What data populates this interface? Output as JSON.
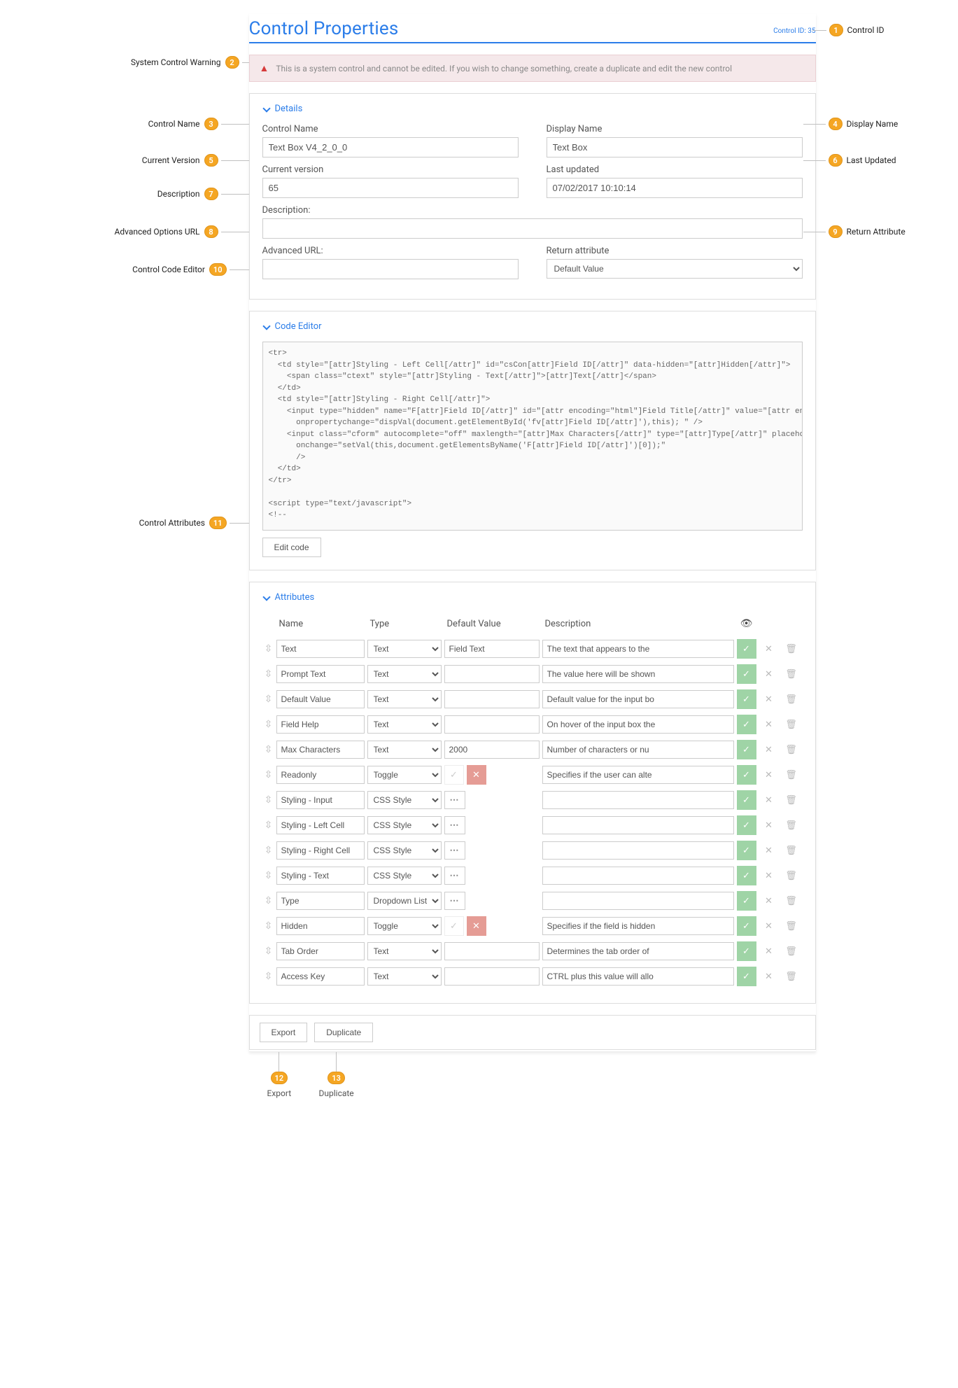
{
  "header": {
    "title": "Control Properties",
    "control_id_label": "Control ID: 35"
  },
  "warning": {
    "text": "This is a system control and cannot be edited. If you wish to change something, create a duplicate and edit the new control"
  },
  "details": {
    "section_title": "Details",
    "control_name_label": "Control Name",
    "control_name_value": "Text Box V4_2_0_0",
    "display_name_label": "Display Name",
    "display_name_value": "Text Box",
    "current_version_label": "Current version",
    "current_version_value": "65",
    "last_updated_label": "Last updated",
    "last_updated_value": "07/02/2017 10:10:14",
    "description_label": "Description:",
    "description_value": "",
    "advanced_url_label": "Advanced URL:",
    "advanced_url_value": "",
    "return_attribute_label": "Return attribute",
    "return_attribute_value": "Default Value"
  },
  "code_editor": {
    "section_title": "Code Editor",
    "code": "<tr>\n  <td style=\"[attr]Styling - Left Cell[/attr]\" id=\"csCon[attr]Field ID[/attr]\" data-hidden=\"[attr]Hidden[/attr]\">\n    <span class=\"ctext\" style=\"[attr]Styling - Text[/attr]\">[attr]Text[/attr]</span>\n  </td>\n  <td style=\"[attr]Styling - Right Cell[/attr]\">\n    <input type=\"hidden\" name=\"F[attr]Field ID[/attr]\" id=\"[attr encoding=\"html\"]Field Title[/attr]\" value=\"[attr encoding\n      onpropertychange=\"dispVal(document.getElementById('fv[attr]Field ID[/attr]'),this); \" />\n    <input class=\"cform\" autocomplete=\"off\" maxlength=\"[attr]Max Characters[/attr]\" type=\"[attr]Type[/attr]\" placeholder=\"\n      onchange=\"setVal(this,document.getElementsByName('F[attr]Field ID[/attr]')[0]);\"\n      />\n  </td>\n</tr>\n\n<script type=\"text/javascript\">\n<!--\n\nsetReadOnly(document.getElementById('fv[attr]Field ID[/attr]'),'[attr]Readonly[/attr]');\nappendLoadFunc(\"dispVal(document.getElementById('fv[attr]Field ID[/attr]'),document.getElementsByName('F[attr]Field ID[/at",
    "edit_button": "Edit code"
  },
  "attributes": {
    "section_title": "Attributes",
    "headers": {
      "name": "Name",
      "type": "Type",
      "default": "Default Value",
      "description": "Description"
    },
    "rows": [
      {
        "name": "Text",
        "type": "Text",
        "default_kind": "text",
        "default": "Field Text",
        "description": "The text that appears to the"
      },
      {
        "name": "Prompt Text",
        "type": "Text",
        "default_kind": "text",
        "default": "",
        "description": "The value here will be shown"
      },
      {
        "name": "Default Value",
        "type": "Text",
        "default_kind": "text",
        "default": "",
        "description": "Default value for the input bo"
      },
      {
        "name": "Field Help",
        "type": "Text",
        "default_kind": "text",
        "default": "",
        "description": "On hover of the input box the"
      },
      {
        "name": "Max Characters",
        "type": "Text",
        "default_kind": "text",
        "default": "2000",
        "description": "Number of characters or nu"
      },
      {
        "name": "Readonly",
        "type": "Toggle",
        "default_kind": "toggle",
        "default": "",
        "description": "Specifies if the user can alte"
      },
      {
        "name": "Styling - Input",
        "type": "CSS Style",
        "default_kind": "dots",
        "default": "",
        "description": ""
      },
      {
        "name": "Styling - Left Cell",
        "type": "CSS Style",
        "default_kind": "dots",
        "default": "",
        "description": ""
      },
      {
        "name": "Styling - Right Cell",
        "type": "CSS Style",
        "default_kind": "dots",
        "default": "",
        "description": ""
      },
      {
        "name": "Styling - Text",
        "type": "CSS Style",
        "default_kind": "dots",
        "default": "",
        "description": ""
      },
      {
        "name": "Type",
        "type": "Dropdown List",
        "default_kind": "dots",
        "default": "",
        "description": ""
      },
      {
        "name": "Hidden",
        "type": "Toggle",
        "default_kind": "toggle",
        "default": "",
        "description": "Specifies if the field is hidden"
      },
      {
        "name": "Tab Order",
        "type": "Text",
        "default_kind": "text",
        "default": "",
        "description": "Determines the tab order of"
      },
      {
        "name": "Access Key",
        "type": "Text",
        "default_kind": "text",
        "default": "",
        "description": "CTRL plus this value will allo"
      }
    ]
  },
  "footer": {
    "export": "Export",
    "duplicate": "Duplicate"
  },
  "callouts": {
    "c1": "Control ID",
    "c2": "System Control Warning",
    "c3": "Control Name",
    "c4": "Display Name",
    "c5": "Current Version",
    "c6": "Last Updated",
    "c7": "Description",
    "c8": "Advanced Options URL",
    "c9": "Return Attribute",
    "c10": "Control Code Editor",
    "c11": "Control Attributes",
    "c12": "Export",
    "c13": "Duplicate"
  }
}
